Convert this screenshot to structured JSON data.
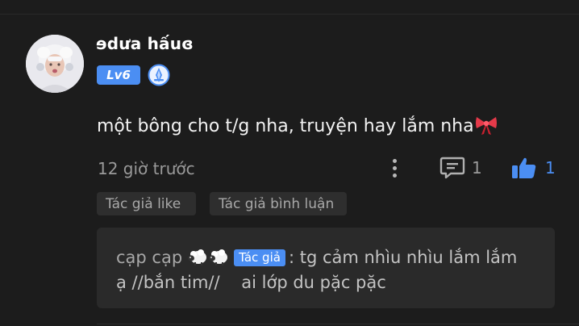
{
  "comment": {
    "username": "ɘdưa hấuɞ",
    "level_badge": "Lv6",
    "text": "một bông cho t/g nha, truyện hay lắm nha",
    "emoji_icon": "ribbon-bow-icon",
    "timestamp": "12 giờ trước",
    "reply_count": "1",
    "like_count": "1",
    "tags": [
      "Tác giả like",
      "Tác giả bình luận"
    ]
  },
  "reply": {
    "author": "cạp cạp",
    "author_badge": "Tác giả",
    "text_line1": ": tg cảm nhìu nhìu lắm lắm",
    "text_line2": "ạ //bắn tim//    ai lớp du pặc pặc"
  },
  "colors": {
    "background": "#1c1c1c",
    "accent": "#4b8ef3",
    "reply_box": "#2a2a2a",
    "muted_text": "#9a9a9a"
  }
}
